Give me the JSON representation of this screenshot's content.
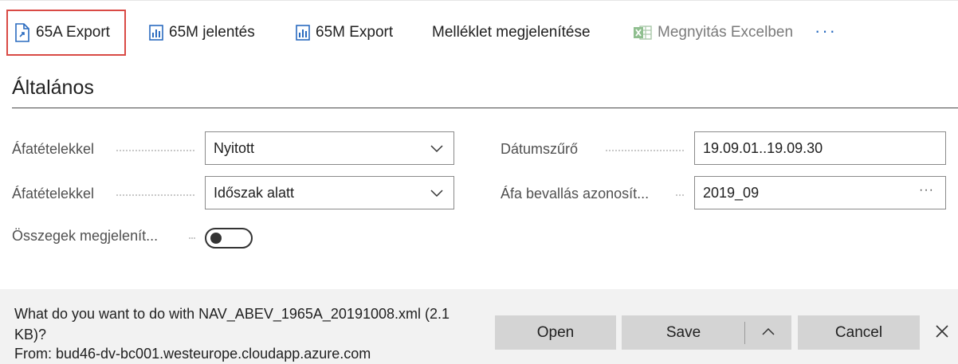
{
  "toolbar": {
    "items": [
      {
        "label": "65A Export",
        "icon": "export-file-icon"
      },
      {
        "label": "65M jelentés",
        "icon": "report-icon"
      },
      {
        "label": "65M Export",
        "icon": "report-icon"
      },
      {
        "label": "Melléklet megjelenítése",
        "icon": ""
      },
      {
        "label": "Megnyitás Excelben",
        "icon": "excel-icon",
        "disabled": true
      }
    ],
    "more": "···",
    "focused_item": "65A Export"
  },
  "section": {
    "title": "Általános"
  },
  "fields": {
    "afatetelekkel_1": {
      "label": "Áfatételekkel",
      "value": "Nyitott"
    },
    "afatetelekkel_2": {
      "label": "Áfatételekkel",
      "value": "Időszak alatt"
    },
    "osszegek": {
      "label": "Összegek megjelenít...",
      "toggle_on": false
    },
    "datumszuro": {
      "label": "Dátumszűrő",
      "value": "19.09.01..19.09.30"
    },
    "afa_bevallas": {
      "label": "Áfa bevallás azonosít...",
      "value": "2019_09"
    }
  },
  "colors": {
    "focus_outline": "#d94a45",
    "accent": "#2a6bbf",
    "download_bar_bg": "#f2f2f2",
    "button_bg": "#d4d4d4"
  },
  "download_bar": {
    "question_line1": "What do you want to do with NAV_ABEV_1965A_20191008.xml (2.1",
    "question_line2": "KB)?",
    "from_line": "From: bud46-dv-bc001.westeurope.cloudapp.azure.com",
    "open_label": "Open",
    "save_label": "Save",
    "save_options_icon": "chevron-up-icon",
    "cancel_label": "Cancel",
    "close_icon": "close-icon"
  }
}
